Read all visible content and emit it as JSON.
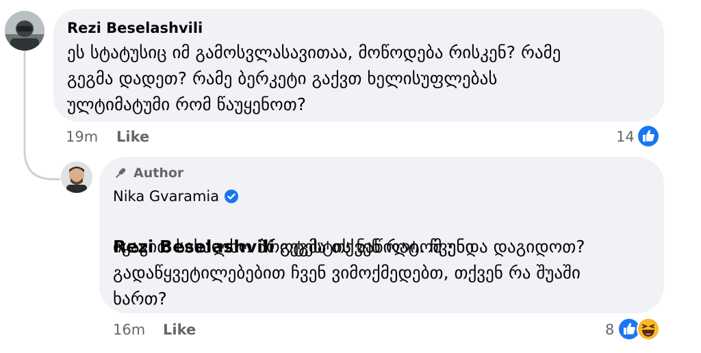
{
  "comment1": {
    "author": "Rezi Beselashvili",
    "text": "ეს სტატუსიც იმ გამოსვლასავითაა, მოწოდება რისკენ? რამე\nგეგმა დადეთ? რამე ბერკეტი გაქვთ ხელისუფლებას\nულტიმატუმი რომ წაუყენოთ?",
    "time": "19m",
    "like_label": "Like",
    "reaction_count": "14"
  },
  "reply1": {
    "badge": "Author",
    "author": "Nika Gvaramia",
    "mention": "Rezi Beselashvili",
    "text_first": " გეგმა თქვენ რატომ უნდა დაგიდოთ?",
    "text_rest": "იყავით სახალხო პროტესტის ნაწილი. ჩვენი\nგადაწყვეტილებებით ჩვენ ვიმოქმედებთ, თქვენ რა შუაში\nხართ?",
    "time": "16m",
    "like_label": "Like",
    "reaction_count": "8"
  },
  "colors": {
    "bubble": "#f0f2f5",
    "secondary_text": "#65676b",
    "like_blue": "#1877f2",
    "verified_blue": "#1877f2"
  }
}
